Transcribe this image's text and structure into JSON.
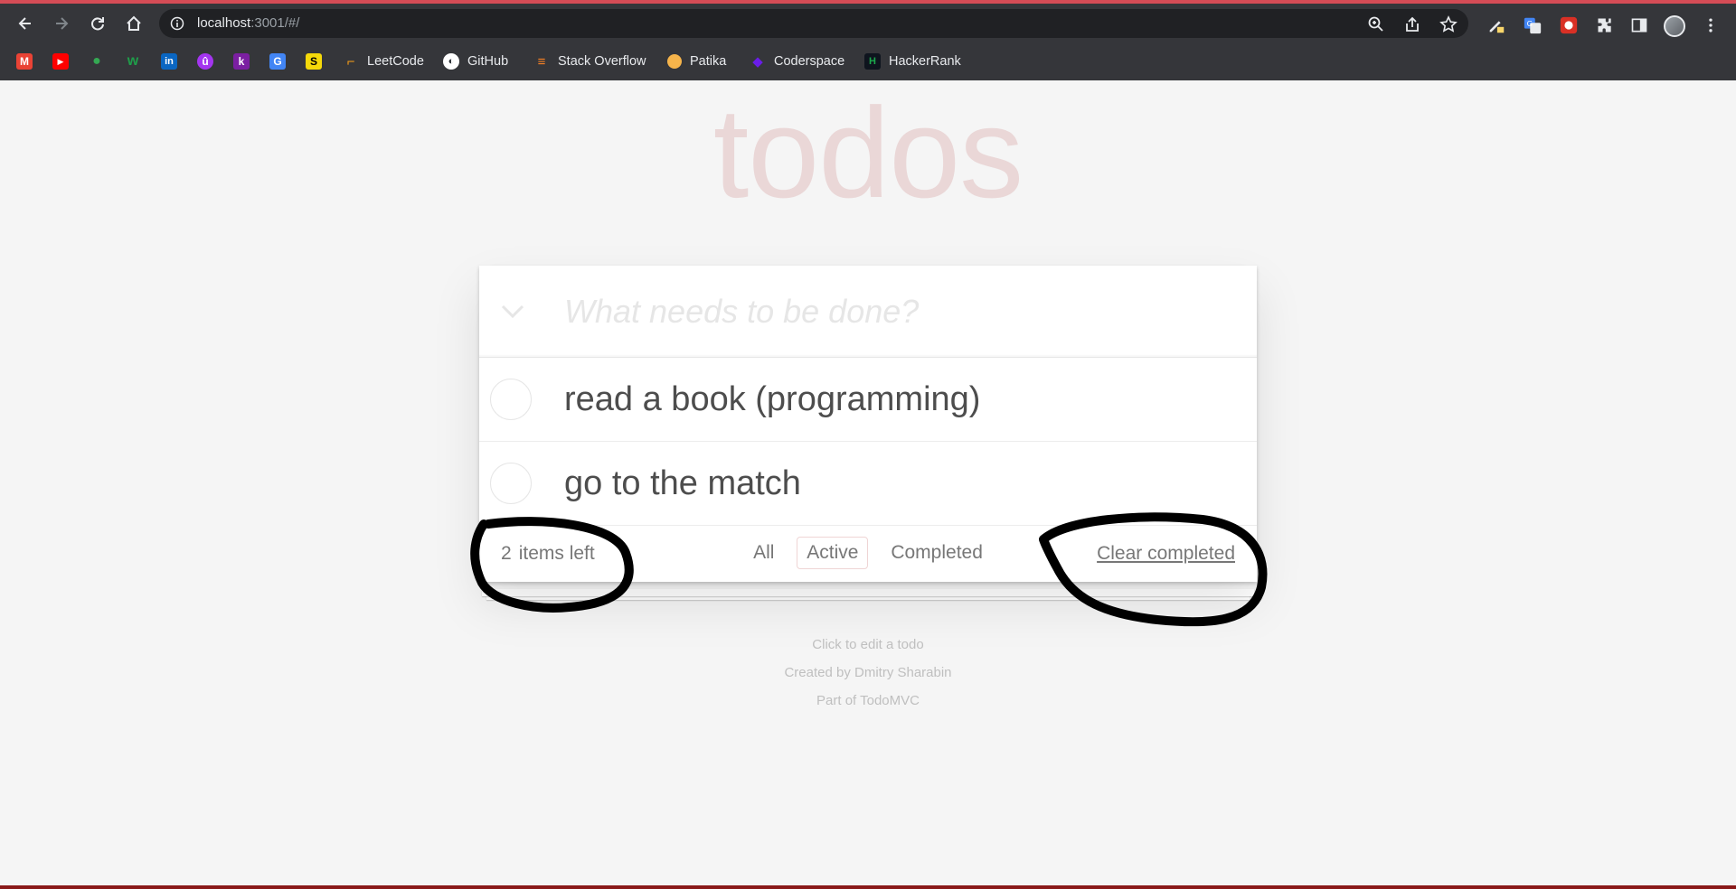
{
  "browser": {
    "url_host": "localhost",
    "url_path": ":3001/#/",
    "bookmarks": [
      {
        "label": "",
        "icon": "gmail-icon",
        "color": "#ea4335",
        "glyph": "M"
      },
      {
        "label": "",
        "icon": "youtube-icon",
        "color": "#ff0000",
        "glyph": "▶"
      },
      {
        "label": "",
        "icon": "maps-icon",
        "color": "#34a853",
        "glyph": "●"
      },
      {
        "label": "",
        "icon": "w-icon",
        "color": "#1f9e4a",
        "glyph": "w"
      },
      {
        "label": "",
        "icon": "linkedin-icon",
        "color": "#0a66c2",
        "glyph": "in"
      },
      {
        "label": "",
        "icon": "udemy-icon",
        "color": "#a435f0",
        "glyph": "û"
      },
      {
        "label": "",
        "icon": "k-icon",
        "color": "#7b1fa2",
        "glyph": "k"
      },
      {
        "label": "",
        "icon": "translate-icon",
        "color": "#4285f4",
        "glyph": "G"
      },
      {
        "label": "",
        "icon": "s-icon",
        "color": "#f5d90a",
        "glyph": "S"
      },
      {
        "label": "LeetCode",
        "icon": "leetcode-icon",
        "color": "#ffa116",
        "glyph": "⌐"
      },
      {
        "label": "GitHub",
        "icon": "github-icon",
        "color": "#ffffff",
        "glyph": "●"
      },
      {
        "label": "Stack Overflow",
        "icon": "stackoverflow-icon",
        "color": "#f48024",
        "glyph": "≡"
      },
      {
        "label": "Patika",
        "icon": "patika-icon",
        "color": "#f6b44b",
        "glyph": "●"
      },
      {
        "label": "Coderspace",
        "icon": "coderspace-icon",
        "color": "#6a1de8",
        "glyph": "◆"
      },
      {
        "label": "HackerRank",
        "icon": "hackerrank-icon",
        "color": "#1ba94c",
        "glyph": "H"
      }
    ]
  },
  "app": {
    "title": "todos",
    "new_todo_placeholder": "What needs to be done?",
    "todos": [
      {
        "text": "read a book (programming)",
        "completed": false
      },
      {
        "text": "go to the match",
        "completed": false
      }
    ],
    "footer": {
      "count": "2",
      "count_label": "items left",
      "filters": [
        {
          "label": "All",
          "selected": false
        },
        {
          "label": "Active",
          "selected": true
        },
        {
          "label": "Completed",
          "selected": false
        }
      ],
      "clear_label": "Clear completed"
    },
    "info": {
      "line1": "Click to edit a todo",
      "line2": "Created by Dmitry Sharabin",
      "line3": "Part of TodoMVC"
    }
  },
  "colors": {
    "chrome_bg": "#35363a",
    "accent": "#d54c56",
    "title": "rgba(175,47,47,0.15)",
    "annotation": "#000000"
  }
}
